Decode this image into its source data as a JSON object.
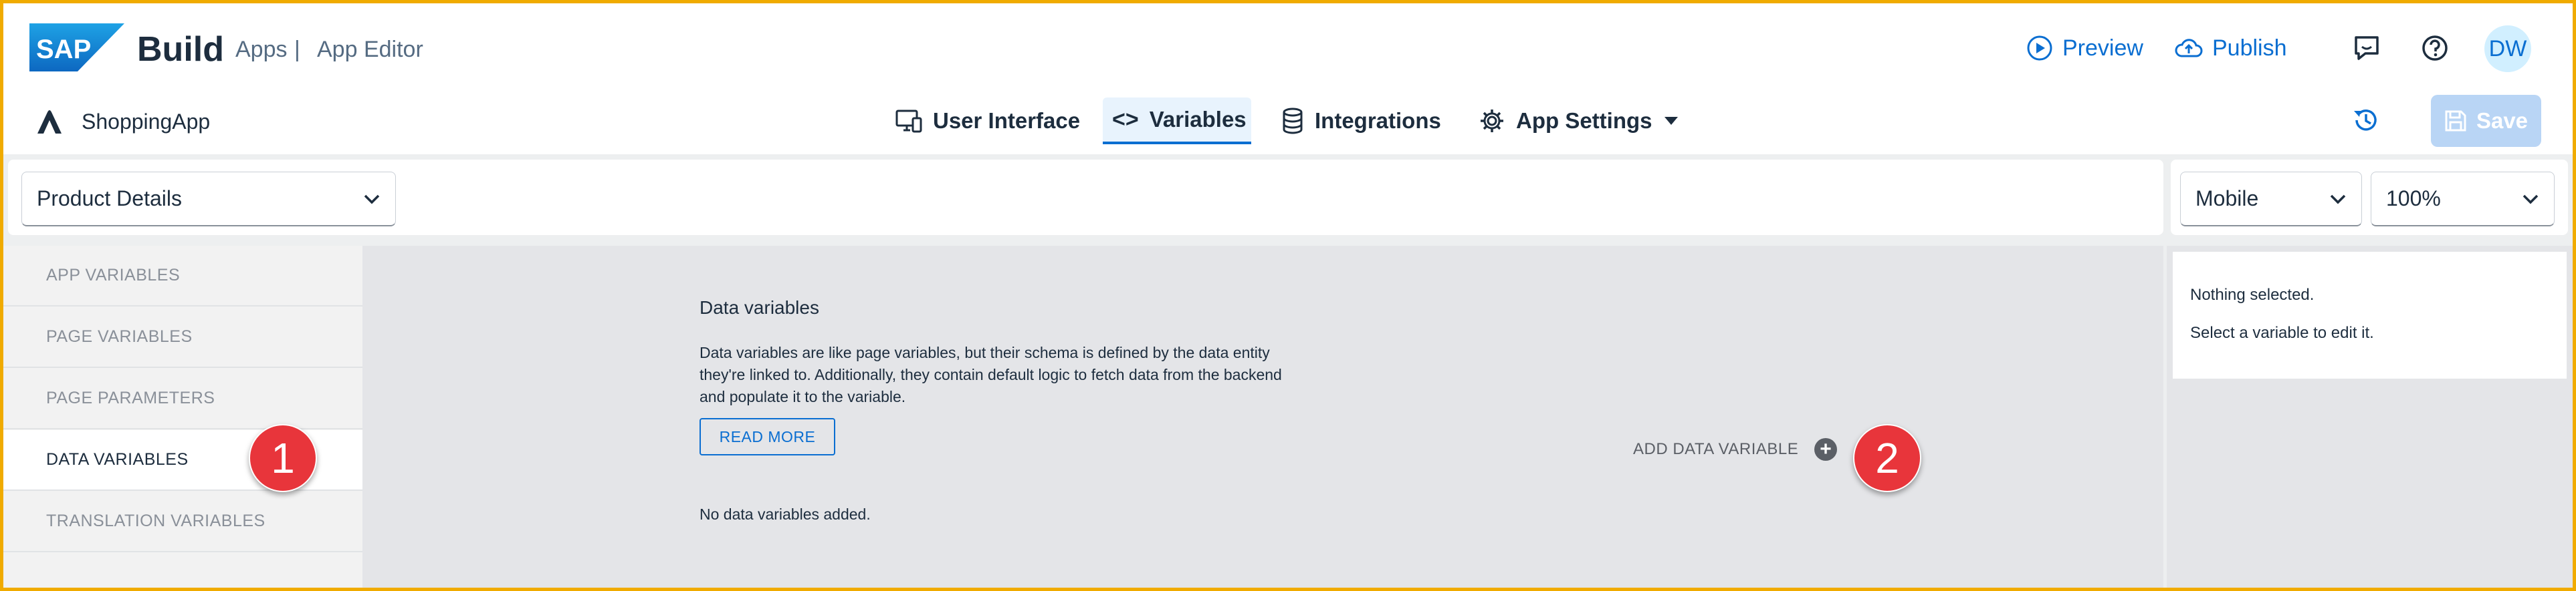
{
  "header": {
    "logo_text": "SAP",
    "brand": "Build",
    "breadcrumb_apps": "Apps",
    "breadcrumb_sep": "|",
    "breadcrumb_editor": "App Editor",
    "preview_label": "Preview",
    "publish_label": "Publish",
    "avatar_initials": "DW",
    "app_name": "ShoppingApp",
    "tabs": [
      {
        "label": "User Interface",
        "icon": "monitor-icon",
        "active": false
      },
      {
        "label": "Variables",
        "icon": "code-icon",
        "active": true
      },
      {
        "label": "Integrations",
        "icon": "database-icon",
        "active": false
      },
      {
        "label": "App Settings",
        "icon": "gear-icon",
        "active": false
      }
    ],
    "save_label": "Save"
  },
  "toolbar": {
    "page_select": "Product Details",
    "device_select": "Mobile",
    "zoom_select": "100%"
  },
  "sidebar": {
    "items": [
      {
        "label": "APP VARIABLES",
        "active": false
      },
      {
        "label": "PAGE VARIABLES",
        "active": false
      },
      {
        "label": "PAGE PARAMETERS",
        "active": false
      },
      {
        "label": "DATA VARIABLES",
        "active": true
      },
      {
        "label": "TRANSLATION VARIABLES",
        "active": false
      }
    ]
  },
  "main": {
    "title": "Data variables",
    "description": "Data variables are like page variables, but their schema is defined by the data entity they're linked to. Additionally, they contain default logic to fetch data from the backend and populate it to the variable.",
    "read_more_label": "READ MORE",
    "add_label": "ADD DATA VARIABLE",
    "empty_text": "No data variables added."
  },
  "properties": {
    "line1": "Nothing selected.",
    "line2": "Select a variable to edit it."
  },
  "callouts": {
    "one": "1",
    "two": "2"
  },
  "colors": {
    "accent": "#0a6ed1",
    "frame": "#f0ab00",
    "callout": "#e8353b"
  }
}
